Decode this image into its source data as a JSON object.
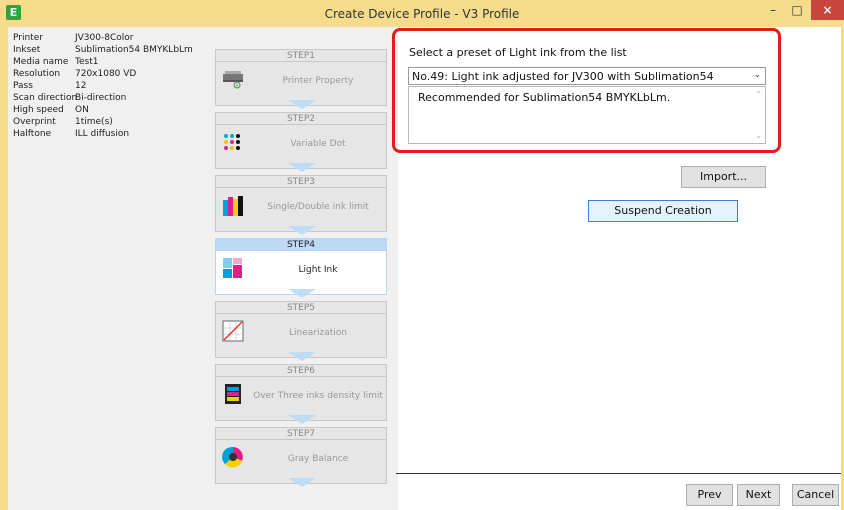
{
  "window": {
    "title": "Create Device Profile - V3 Profile",
    "app_icon": "E",
    "minimize": "–",
    "maximize": "□",
    "close": "×"
  },
  "info": [
    {
      "key": "Printer",
      "value": "JV300-8Color"
    },
    {
      "key": "Inkset",
      "value": "Sublimation54 BMYKLbLm"
    },
    {
      "key": "Media name",
      "value": "Test1"
    },
    {
      "key": "Resolution",
      "value": "720x1080 VD"
    },
    {
      "key": "Pass",
      "value": "12"
    },
    {
      "key": "Scan direction",
      "value": "Bi-direction"
    },
    {
      "key": "High speed",
      "value": "ON"
    },
    {
      "key": "Overprint",
      "value": "1time(s)"
    },
    {
      "key": "Halftone",
      "value": "ILL diffusion"
    }
  ],
  "steps": [
    {
      "head": "STEP1",
      "name": "Printer Property",
      "icon": "printer-icon"
    },
    {
      "head": "STEP2",
      "name": "Variable Dot",
      "icon": "dots-icon"
    },
    {
      "head": "STEP3",
      "name": "Single/Double ink limit",
      "icon": "ink-bars-icon"
    },
    {
      "head": "STEP4",
      "name": "Light Ink",
      "icon": "light-ink-icon",
      "active": true
    },
    {
      "head": "STEP5",
      "name": "Linearization",
      "icon": "linearization-icon"
    },
    {
      "head": "STEP6",
      "name": "Over Three inks density limit",
      "icon": "density-icon"
    },
    {
      "head": "STEP7",
      "name": "Gray Balance",
      "icon": "gray-balance-icon"
    }
  ],
  "main": {
    "preset_label": "Select a preset of Light ink from the list",
    "selected_preset": "No.49: Light ink adjusted for JV300 with Sublimation54",
    "description": "Recommended for Sublimation54 BMYKLbLm.",
    "import_label": "Import...",
    "suspend_label": "Suspend Creation"
  },
  "nav": {
    "prev": "Prev",
    "next": "Next",
    "cancel": "Cancel"
  },
  "colors": {
    "frame": "#f5dc8b",
    "highlight": "#e21c1c",
    "active_step": "#bdd9f6"
  }
}
